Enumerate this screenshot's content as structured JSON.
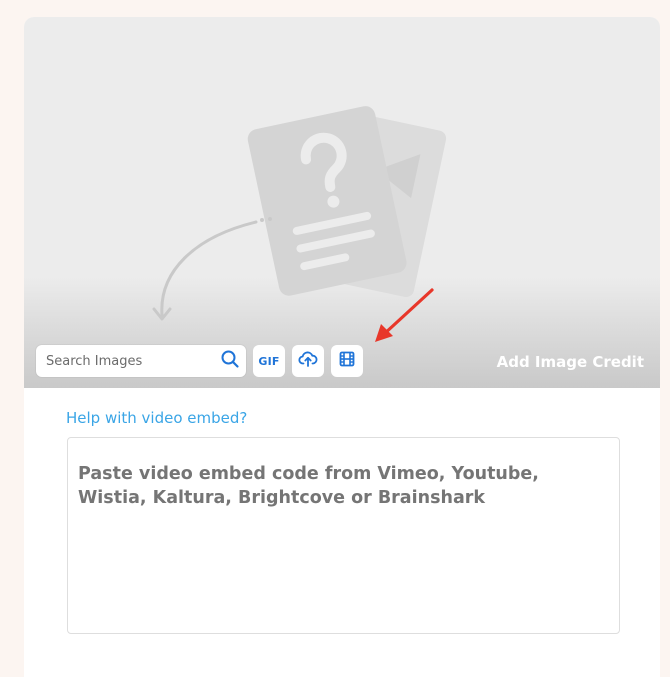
{
  "image_panel": {
    "placeholder_icon": "missing-image-document-icon",
    "search": {
      "placeholder": "Search Images",
      "value": "",
      "icon": "search-icon"
    },
    "tools": [
      {
        "name": "gif",
        "label": "GIF"
      },
      {
        "name": "upload",
        "icon": "cloud-upload-icon"
      },
      {
        "name": "video",
        "icon": "film-icon"
      }
    ],
    "add_credit_label": "Add Image Credit",
    "annotation": "red-arrow-pointing-to-video-button"
  },
  "video_embed": {
    "help_link": "Help with video embed?",
    "placeholder": "Paste video embed code from Vimeo, Youtube, Wistia, Kaltura, Brightcove or Brainshark",
    "value": ""
  },
  "colors": {
    "page_background": "#fcf5f1",
    "accent_blue": "#1f74d8",
    "link_blue": "#3aa5e6",
    "annotation_red": "#e8372a",
    "placeholder_gray": "#757575"
  }
}
